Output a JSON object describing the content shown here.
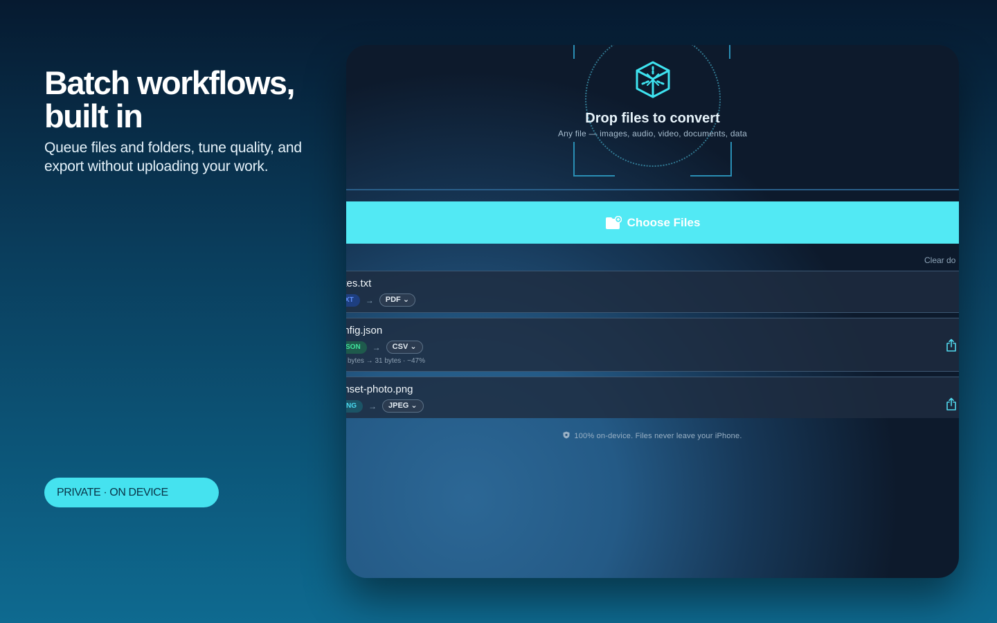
{
  "hero": {
    "title_line1": "Batch workflows,",
    "title_line2": "built in",
    "subtitle_line1": "Queue files and folders, tune quality, and",
    "subtitle_line2": "export without uploading your work."
  },
  "badge": {
    "label": "PRIVATE · ON DEVICE",
    "color": "#45e2ef"
  },
  "dropzone": {
    "title": "Drop files to convert",
    "subtitle": "Any file — images, audio, video, documents, data",
    "icon": "cube-icon"
  },
  "choose_button": {
    "label": "Choose Files",
    "icon": "folder-add-icon",
    "color": "#52e9f4"
  },
  "queue": {
    "clear_label": "Clear do",
    "files": [
      {
        "name": "otes.txt",
        "from": "XT",
        "from_color": "#3b6df0",
        "to": "PDF",
        "meta": ""
      },
      {
        "name": "onfig.json",
        "from": "SON",
        "from_color": "#35c98a",
        "to": "CSV",
        "meta": "bytes → 31 bytes · −47%"
      },
      {
        "name": "unset-photo.png",
        "from": "NG",
        "from_color": "#2fc7e0",
        "to": "JPEG",
        "meta": ""
      }
    ]
  },
  "footer": {
    "text": "100% on-device. Files never leave your iPhone.",
    "icon": "shield-icon"
  }
}
